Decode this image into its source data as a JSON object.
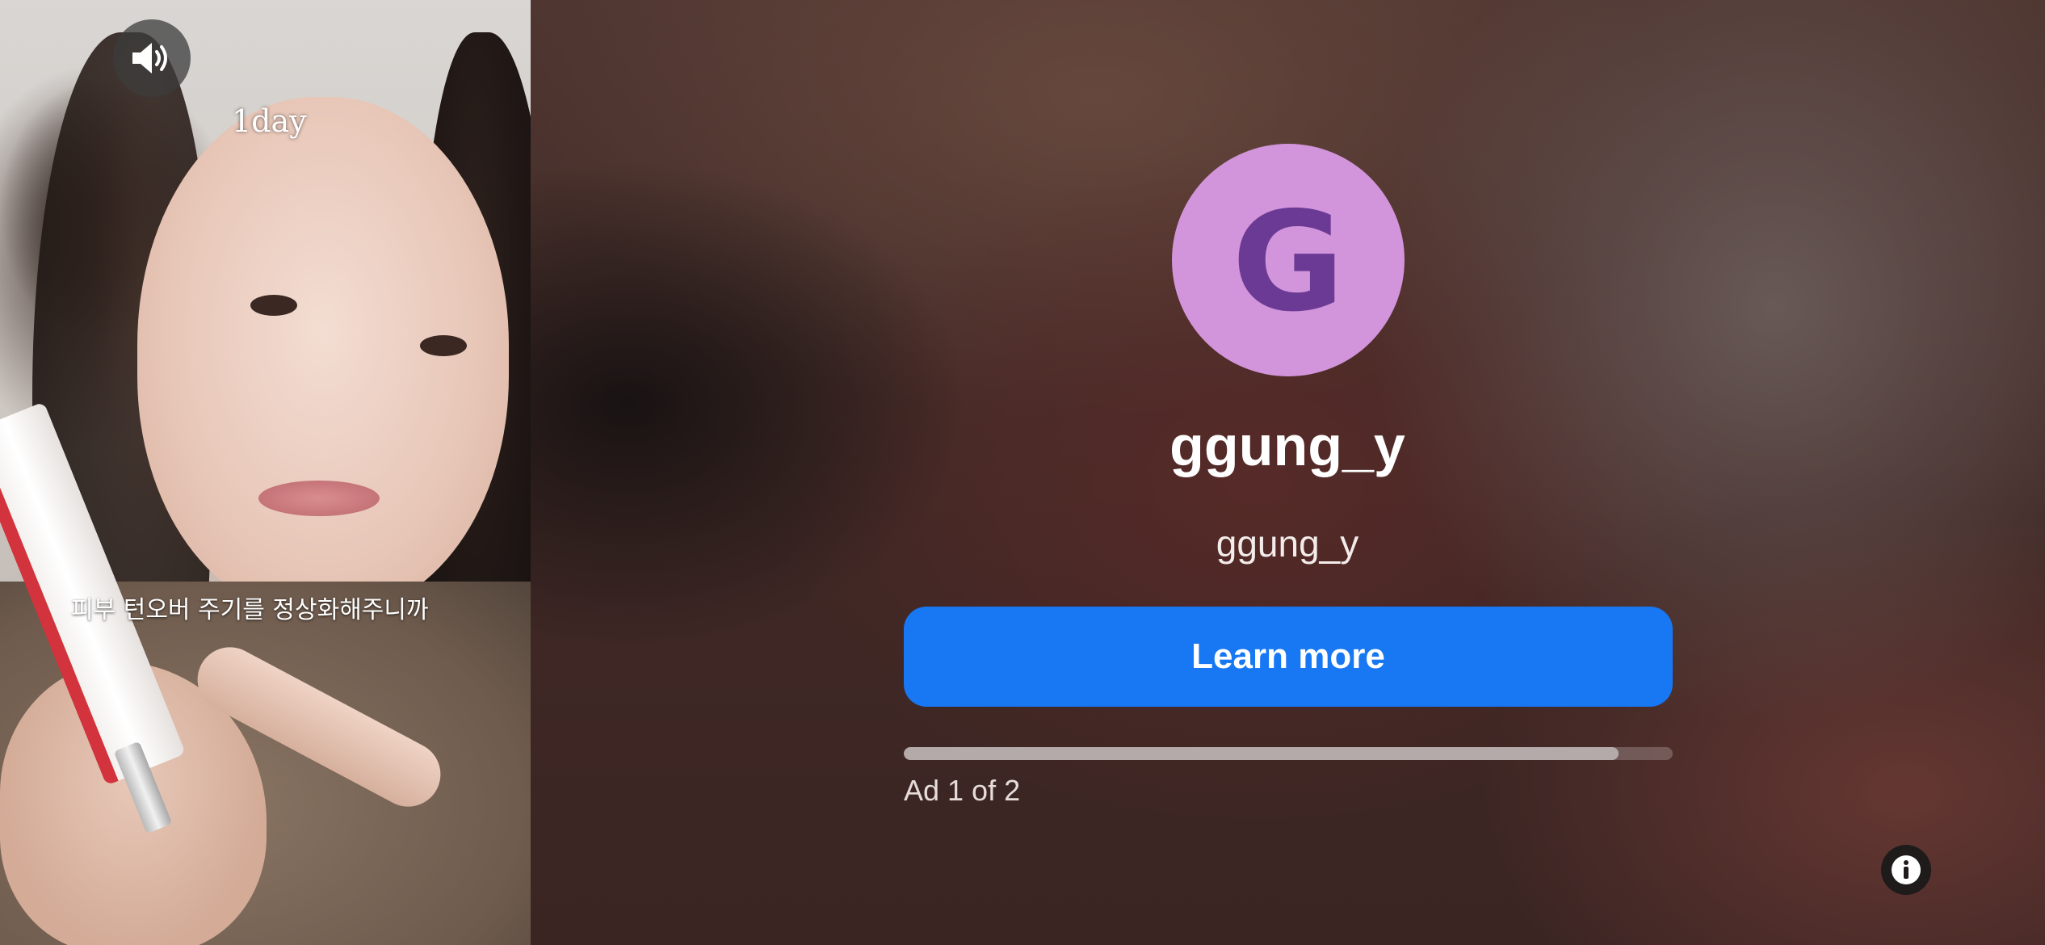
{
  "video": {
    "sound_icon": "speaker-volume-icon",
    "day_label": "1day",
    "subtitle": "피부 턴오버 주기를 정상화해주니까"
  },
  "ad_card": {
    "avatar_letter": "G",
    "avatar_color": "#d294da",
    "avatar_letter_color": "#6a3a94",
    "advertiser_name": "ggung_y",
    "advertiser_handle": "ggung_y",
    "cta_label": "Learn more",
    "cta_color": "#1877f2",
    "progress_fraction": 0.93,
    "ad_counter": "Ad 1 of 2",
    "info_icon": "info-icon"
  }
}
